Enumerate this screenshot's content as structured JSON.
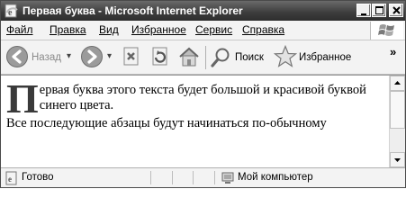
{
  "window": {
    "title": "Первая буква - Microsoft Internet Explorer"
  },
  "menu": [
    {
      "label": "Файл"
    },
    {
      "label": "Правка"
    },
    {
      "label": "Вид"
    },
    {
      "label": "Избранное"
    },
    {
      "label": "Сервис"
    },
    {
      "label": "Справка"
    }
  ],
  "toolbar": {
    "back_label": "Назад",
    "search_label": "Поиск",
    "favorites_label": "Избранное",
    "overflow": "»"
  },
  "document": {
    "dropcap": "П",
    "paragraph1": "ервая буква этого текста будет большой и красивой буквой синего цвета.",
    "paragraph2": "Все последующие абзацы будут начинаться по-обычному"
  },
  "status": {
    "text": "Готово",
    "zone": "Мой компьютер"
  },
  "icons": [
    "ie-page-icon",
    "minimize-icon",
    "maximize-icon",
    "close-icon",
    "windows-logo-icon",
    "back-arrow-icon",
    "forward-arrow-icon",
    "stop-icon",
    "refresh-icon",
    "home-icon",
    "search-icon",
    "favorites-star-icon",
    "scroll-up-icon",
    "scroll-down-icon",
    "page-status-icon",
    "computer-icon"
  ]
}
